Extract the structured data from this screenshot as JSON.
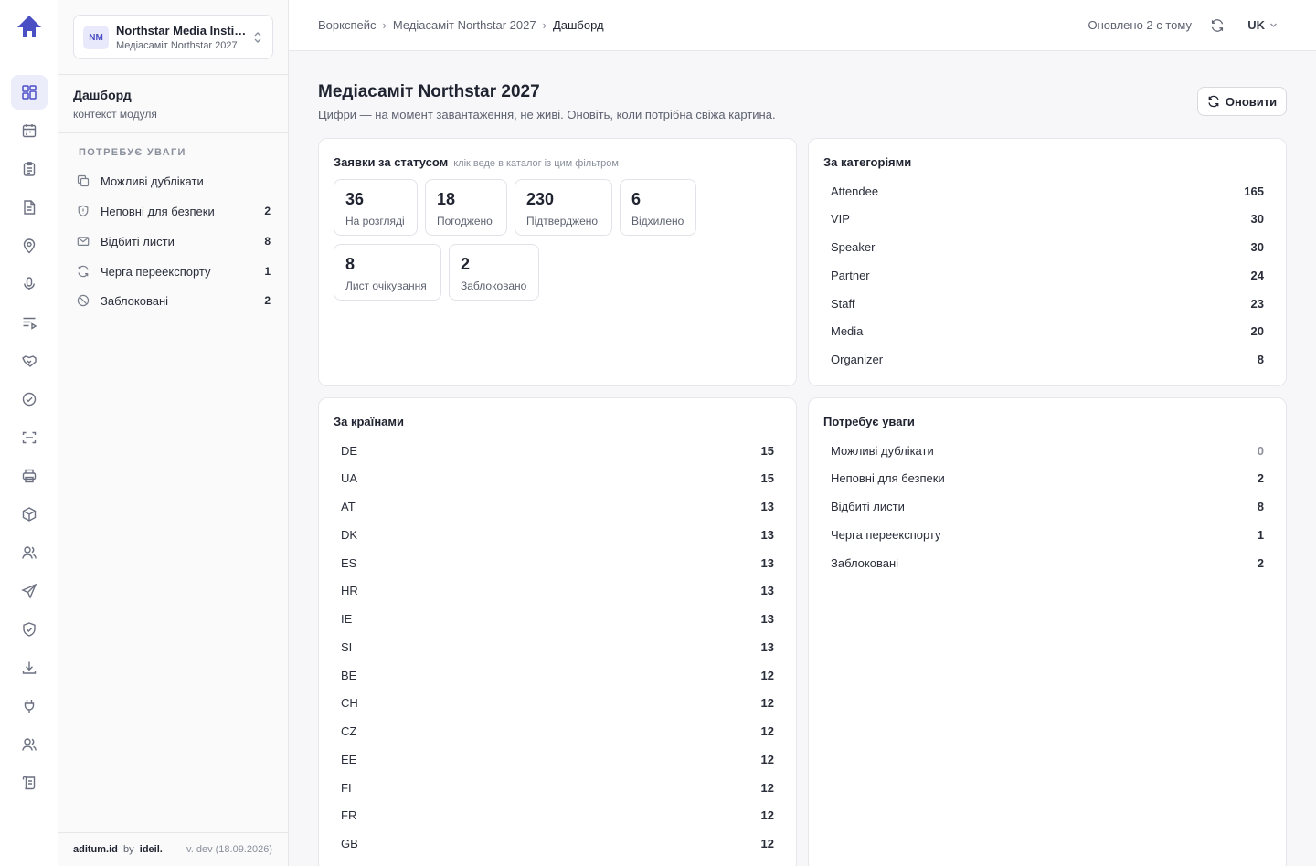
{
  "workspace": {
    "initials": "NM",
    "name": "Northstar Media Institute",
    "event": "Медіасаміт Northstar 2027"
  },
  "module": {
    "title": "Дашборд",
    "subtitle": "контекст модуля"
  },
  "attention_sidebar": {
    "heading": "ПОТРЕБУЄ УВАГИ",
    "items": [
      {
        "label": "Можливі дублікати",
        "count": "",
        "icon": "copy-icon"
      },
      {
        "label": "Неповні для безпеки",
        "count": "2",
        "icon": "shield-icon"
      },
      {
        "label": "Відбиті листи",
        "count": "8",
        "icon": "mail-icon"
      },
      {
        "label": "Черга переекспорту",
        "count": "1",
        "icon": "refresh-icon"
      },
      {
        "label": "Заблоковані",
        "count": "2",
        "icon": "blocked-icon"
      }
    ]
  },
  "footer": {
    "brand": "aditum.id",
    "by": "by",
    "company": "ideil.",
    "version": "v. dev (18.09.2026)"
  },
  "topbar": {
    "breadcrumb": [
      "Воркспейс",
      "Медіасаміт Northstar 2027",
      "Дашборд"
    ],
    "updated": "Оновлено 2 с тому",
    "lang": "UK"
  },
  "page": {
    "title": "Медіасаміт Northstar 2027",
    "subtitle": "Цифри — на момент завантаження, не живі. Оновіть, коли потрібна свіжа картина.",
    "refresh_label": "Оновити"
  },
  "status_card": {
    "title": "Заявки за статусом",
    "hint": "клік веде в каталог із цим фільтром",
    "tiles": [
      {
        "value": "36",
        "label": "На розгляді"
      },
      {
        "value": "18",
        "label": "Погоджено"
      },
      {
        "value": "230",
        "label": "Підтверджено"
      },
      {
        "value": "6",
        "label": "Відхилено"
      },
      {
        "value": "8",
        "label": "Лист очікування"
      },
      {
        "value": "2",
        "label": "Заблоковано"
      }
    ]
  },
  "categories_card": {
    "title": "За категоріями",
    "rows": [
      {
        "k": "Attendee",
        "v": "165"
      },
      {
        "k": "VIP",
        "v": "30"
      },
      {
        "k": "Speaker",
        "v": "30"
      },
      {
        "k": "Partner",
        "v": "24"
      },
      {
        "k": "Staff",
        "v": "23"
      },
      {
        "k": "Media",
        "v": "20"
      },
      {
        "k": "Organizer",
        "v": "8"
      }
    ]
  },
  "countries_card": {
    "title": "За країнами",
    "rows": [
      {
        "k": "DE",
        "v": "15"
      },
      {
        "k": "UA",
        "v": "15"
      },
      {
        "k": "AT",
        "v": "13"
      },
      {
        "k": "DK",
        "v": "13"
      },
      {
        "k": "ES",
        "v": "13"
      },
      {
        "k": "HR",
        "v": "13"
      },
      {
        "k": "IE",
        "v": "13"
      },
      {
        "k": "SI",
        "v": "13"
      },
      {
        "k": "BE",
        "v": "12"
      },
      {
        "k": "CH",
        "v": "12"
      },
      {
        "k": "CZ",
        "v": "12"
      },
      {
        "k": "EE",
        "v": "12"
      },
      {
        "k": "FI",
        "v": "12"
      },
      {
        "k": "FR",
        "v": "12"
      },
      {
        "k": "GB",
        "v": "12"
      }
    ]
  },
  "attention_card": {
    "title": "Потребує уваги",
    "rows": [
      {
        "k": "Можливі дублікати",
        "v": "0"
      },
      {
        "k": "Неповні для безпеки",
        "v": "2"
      },
      {
        "k": "Відбиті листи",
        "v": "8"
      },
      {
        "k": "Черга переекспорту",
        "v": "1"
      },
      {
        "k": "Заблоковані",
        "v": "2"
      }
    ]
  },
  "rail_icons": [
    "dashboard-icon",
    "calendar-icon",
    "clipboard-icon",
    "document-icon",
    "location-icon",
    "microphone-icon",
    "agenda-icon",
    "handshake-icon",
    "check-circle-icon",
    "scan-icon",
    "printer-icon",
    "package-icon",
    "users-icon",
    "send-icon",
    "shield-check-icon",
    "download-icon",
    "plug-icon",
    "team-icon",
    "scroll-icon"
  ],
  "colors": {
    "accent": "#4b4fc4",
    "accent_bg": "#ecedfb",
    "muted": "#5d6270",
    "border": "#e6e7eb"
  }
}
